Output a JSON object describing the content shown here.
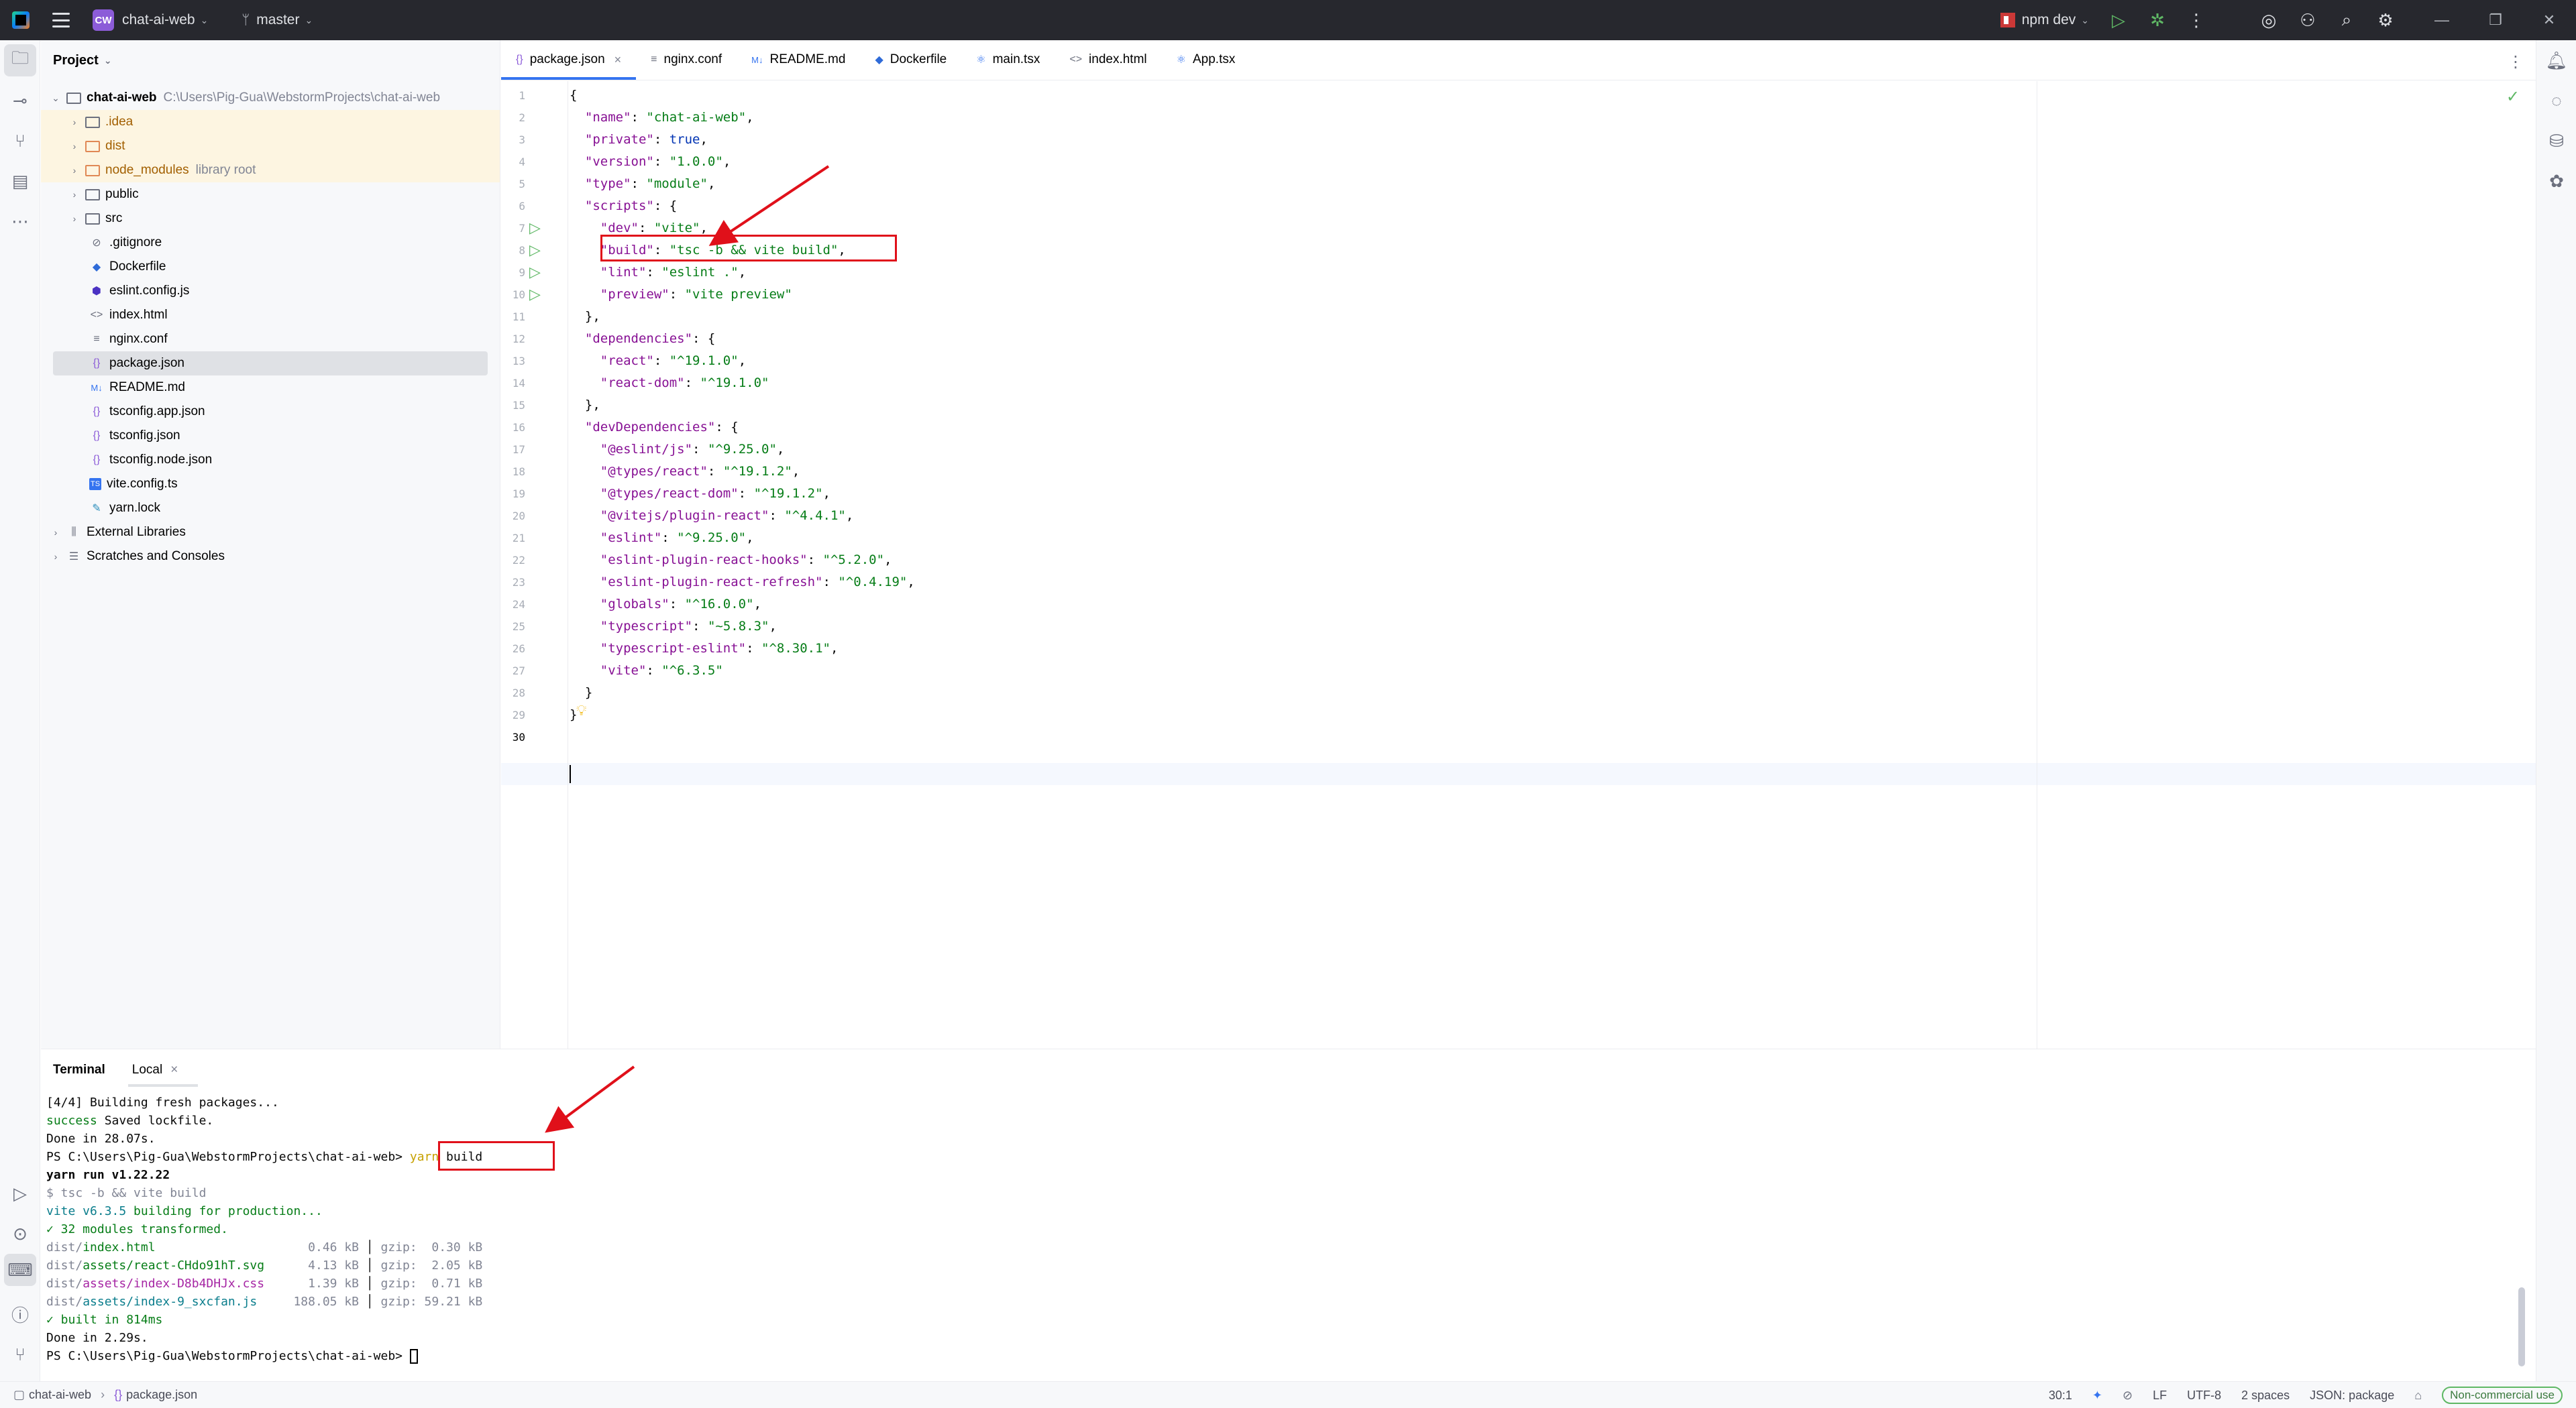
{
  "titlebar": {
    "project_badge": "CW",
    "project_name": "chat-ai-web",
    "branch": "master",
    "run_config": "npm dev"
  },
  "project_panel": {
    "title": "Project",
    "root_name": "chat-ai-web",
    "root_path": "C:\\Users\\Pig-Gua\\WebstormProjects\\chat-ai-web",
    "items": [
      {
        "label": ".idea"
      },
      {
        "label": "dist"
      },
      {
        "label": "node_modules",
        "hint": "library root"
      },
      {
        "label": "public"
      },
      {
        "label": "src"
      },
      {
        "label": ".gitignore"
      },
      {
        "label": "Dockerfile"
      },
      {
        "label": "eslint.config.js"
      },
      {
        "label": "index.html"
      },
      {
        "label": "nginx.conf"
      },
      {
        "label": "package.json"
      },
      {
        "label": "README.md"
      },
      {
        "label": "tsconfig.app.json"
      },
      {
        "label": "tsconfig.json"
      },
      {
        "label": "tsconfig.node.json"
      },
      {
        "label": "vite.config.ts"
      },
      {
        "label": "yarn.lock"
      },
      {
        "label": "External Libraries"
      },
      {
        "label": "Scratches and Consoles"
      }
    ]
  },
  "editor": {
    "tabs": [
      {
        "label": "package.json",
        "icon": "{}"
      },
      {
        "label": "nginx.conf",
        "icon": "≡"
      },
      {
        "label": "README.md",
        "icon": "M↓"
      },
      {
        "label": "Dockerfile",
        "icon": "docker"
      },
      {
        "label": "main.tsx",
        "icon": "react"
      },
      {
        "label": "index.html",
        "icon": "<>"
      },
      {
        "label": "App.tsx",
        "icon": "react"
      }
    ],
    "active_tab": "package.json",
    "line_numbers": [
      "1",
      "2",
      "3",
      "4",
      "5",
      "6",
      "7",
      "8",
      "9",
      "10",
      "11",
      "12",
      "13",
      "14",
      "15",
      "16",
      "17",
      "18",
      "19",
      "20",
      "21",
      "22",
      "23",
      "24",
      "25",
      "26",
      "27",
      "28",
      "29",
      "30"
    ],
    "code": {
      "l1": "{",
      "l2_key": "\"name\"",
      "l2_val": "\"chat-ai-web\"",
      "l3_key": "\"private\"",
      "l3_val": "true",
      "l4_key": "\"version\"",
      "l4_val": "\"1.0.0\"",
      "l5_key": "\"type\"",
      "l5_val": "\"module\"",
      "l6_key": "\"scripts\"",
      "l7_key": "\"dev\"",
      "l7_val": "\"vite\"",
      "l8_key": "\"build\"",
      "l8_val": "\"tsc -b && vite build\"",
      "l9_key": "\"lint\"",
      "l9_val": "\"eslint .\"",
      "l10_key": "\"preview\"",
      "l10_val": "\"vite preview\"",
      "l11": "},",
      "l12_key": "\"dependencies\"",
      "l13_key": "\"react\"",
      "l13_val": "\"^19.1.0\"",
      "l14_key": "\"react-dom\"",
      "l14_val": "\"^19.1.0\"",
      "l15": "},",
      "l16_key": "\"devDependencies\"",
      "l17_key": "\"@eslint/js\"",
      "l17_val": "\"^9.25.0\"",
      "l18_key": "\"@types/react\"",
      "l18_val": "\"^19.1.2\"",
      "l19_key": "\"@types/react-dom\"",
      "l19_val": "\"^19.1.2\"",
      "l20_key": "\"@vitejs/plugin-react\"",
      "l20_val": "\"^4.4.1\"",
      "l21_key": "\"eslint\"",
      "l21_val": "\"^9.25.0\"",
      "l22_key": "\"eslint-plugin-react-hooks\"",
      "l22_val": "\"^5.2.0\"",
      "l23_key": "\"eslint-plugin-react-refresh\"",
      "l23_val": "\"^0.4.19\"",
      "l24_key": "\"globals\"",
      "l24_val": "\"^16.0.0\"",
      "l25_key": "\"typescript\"",
      "l25_val": "\"~5.8.3\"",
      "l26_key": "\"typescript-eslint\"",
      "l26_val": "\"^8.30.1\"",
      "l27_key": "\"vite\"",
      "l27_val": "\"^6.3.5\"",
      "l28": "}",
      "l29": "}"
    }
  },
  "terminal": {
    "title": "Terminal",
    "tab": "Local",
    "lines": {
      "t1": "[4/4] Building fresh packages...",
      "t2a": "success",
      "t2b": " Saved lockfile.",
      "t3": "Done in 28.07s.",
      "prompt": "PS C:\\Users\\Pig-Gua\\WebstormProjects\\chat-ai-web>",
      "cmd1": "yarn",
      "cmd2": " build",
      "t5": "yarn run v1.22.22",
      "t6": "$ tsc -b && vite build",
      "t7a": "vite v6.3.5",
      "t7b": " building for production...",
      "t8": "✓ 32 modules transformed.",
      "f1_dir": "dist/",
      "f1_name": "index.html",
      "f1_size": "  0.46 kB",
      "f1_gzip": "gzip:  0.30 kB",
      "f2_dir": "dist/",
      "f2_name": "assets/react-CHdo91hT.svg",
      "f2_size": "  4.13 kB",
      "f2_gzip": "gzip:  2.05 kB",
      "f3_dir": "dist/",
      "f3_name": "assets/index-D8b4DHJx.css",
      "f3_size": "  1.39 kB",
      "f3_gzip": "gzip:  0.71 kB",
      "f4_dir": "dist/",
      "f4_name": "assets/index-9_sxcfan.js",
      "f4_size": "188.05 kB",
      "f4_gzip": "gzip: 59.21 kB",
      "t13": "✓ built in 814ms",
      "t14": "Done in 2.29s."
    }
  },
  "statusbar": {
    "crumb_project": "chat-ai-web",
    "crumb_file": "package.json",
    "position": "30:1",
    "line_sep": "LF",
    "encoding": "UTF-8",
    "indent": "2 spaces",
    "schema": "JSON: package",
    "license": "Non-commercial use"
  },
  "colors": {
    "accent": "#3574f0",
    "annotation": "#e0101a",
    "json_key": "#871094",
    "json_string": "#067d17",
    "keyword": "#0033b3"
  }
}
